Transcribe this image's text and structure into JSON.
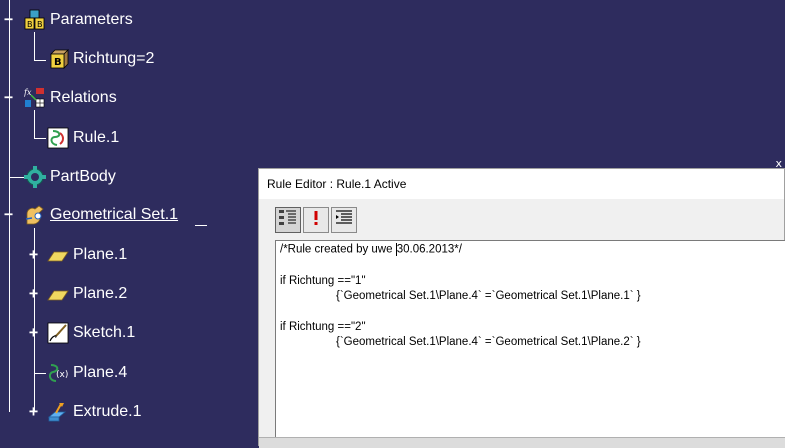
{
  "tree": {
    "nodes": [
      {
        "label": "Parameters",
        "icon": "parameters-icon"
      },
      {
        "label": "Richtung=2",
        "icon": "parameter-icon"
      },
      {
        "label": "Relations",
        "icon": "relations-icon"
      },
      {
        "label": "Rule.1",
        "icon": "rule-icon"
      },
      {
        "label": "PartBody",
        "icon": "partbody-icon"
      },
      {
        "label": "Geometrical Set.1",
        "icon": "geometrical-set-icon"
      },
      {
        "label": "Plane.1",
        "icon": "plane-icon"
      },
      {
        "label": "Plane.2",
        "icon": "plane-icon"
      },
      {
        "label": "Sketch.1",
        "icon": "sketch-icon"
      },
      {
        "label": "Plane.4",
        "icon": "formula-plane-icon"
      },
      {
        "label": "Extrude.1",
        "icon": "extrude-icon"
      }
    ],
    "expanders": {
      "collapse": "−",
      "expand": "+"
    }
  },
  "dialog": {
    "title": "Rule Editor : Rule.1 Active",
    "close_glyph": "x",
    "toolbar": [
      {
        "name": "variables-button",
        "icon": "tree-list-icon"
      },
      {
        "name": "alert-button",
        "icon": "exclamation-icon"
      },
      {
        "name": "indent-button",
        "icon": "indent-icon"
      }
    ],
    "code_lines": [
      "/*Rule created by uwe ",
      "30.06.2013*/",
      "if Richtung ==\"1\"",
      "{`Geometrical Set.1\\Plane.4` =`Geometrical Set.1\\Plane.1` }",
      "if Richtung ==\"2\"",
      "{`Geometrical Set.1\\Plane.4` =`Geometrical Set.1\\Plane.2` }"
    ]
  },
  "colors": {
    "background": "#2e2c5e",
    "tree_text": "#ffffff",
    "dialog_bg": "#f0f0f0"
  }
}
